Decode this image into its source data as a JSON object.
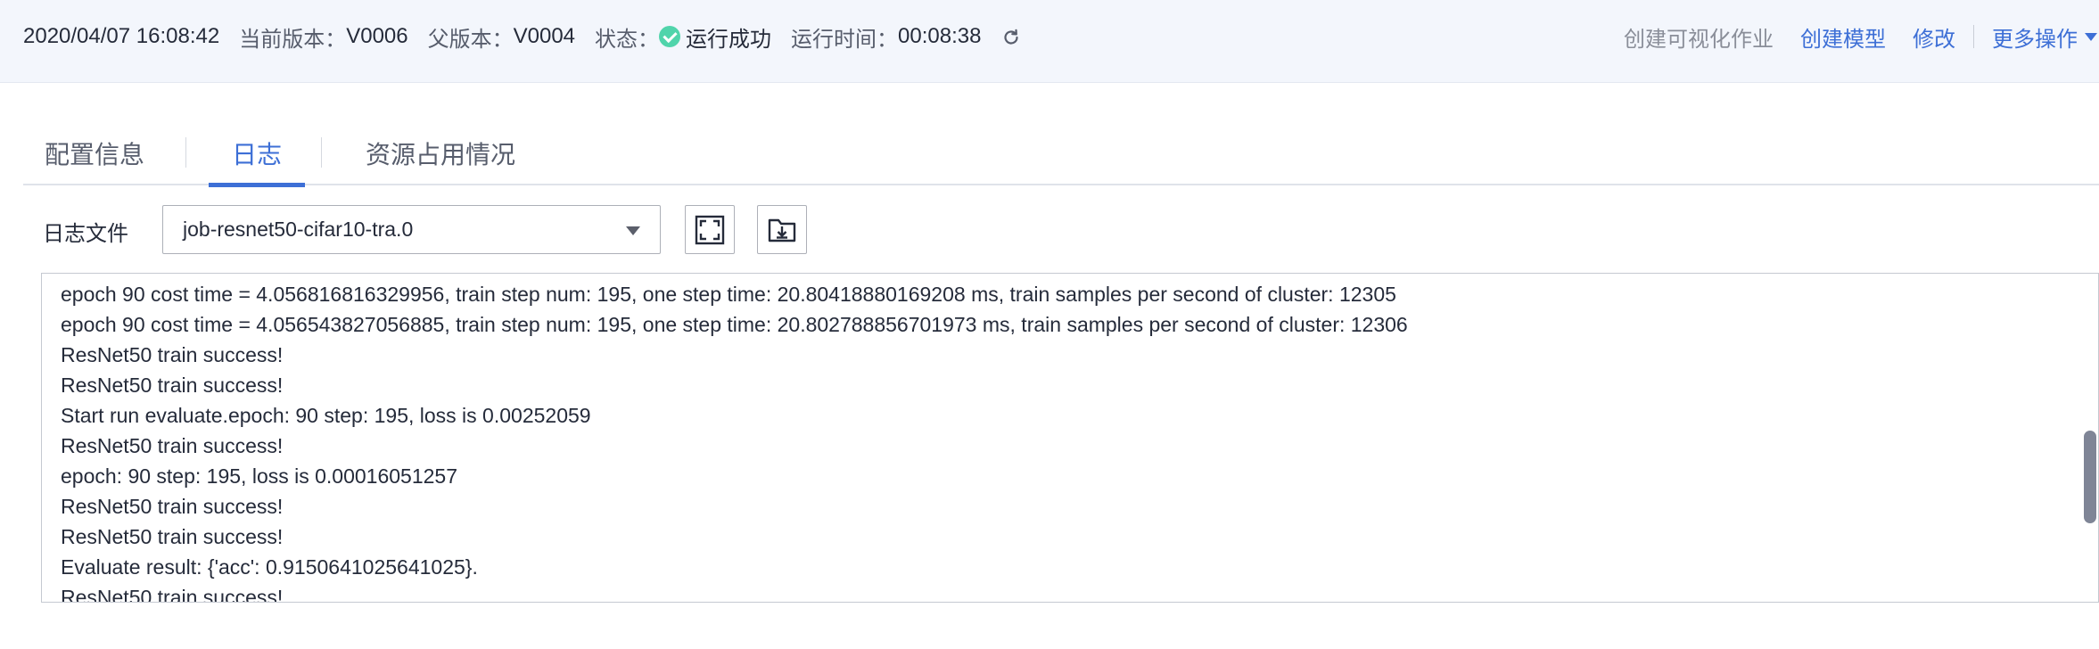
{
  "header": {
    "datetime": "2020/04/07 16:08:42",
    "current_version_label": "当前版本：",
    "current_version": "V0006",
    "parent_version_label": "父版本：",
    "parent_version": "V0004",
    "status_label": "状态：",
    "status_value": "运行成功",
    "runtime_label": "运行时间：",
    "runtime_value": "00:08:38",
    "actions": {
      "create_visual_job": "创建可视化作业",
      "create_model": "创建模型",
      "edit": "修改",
      "more": "更多操作"
    }
  },
  "tabs": [
    "配置信息",
    "日志",
    "资源占用情况"
  ],
  "active_tab": 1,
  "log_file": {
    "label": "日志文件",
    "selected": "job-resnet50-cifar10-tra.0"
  },
  "log_lines": [
    "epoch 90 cost time = 4.056816816329956, train step num: 195, one step time: 20.80418880169208 ms, train samples per second of cluster: 12305",
    "epoch 90 cost time = 4.056543827056885, train step num: 195, one step time: 20.802788856701973 ms, train samples per second of cluster: 12306",
    "ResNet50 train success!",
    "ResNet50 train success!",
    "Start run evaluate.epoch: 90 step: 195, loss is 0.00252059",
    "ResNet50 train success!",
    "epoch: 90 step: 195, loss is 0.00016051257",
    "ResNet50 train success!",
    "ResNet50 train success!",
    "Evaluate result: {'acc': 0.9150641025641025}.",
    "ResNet50 train success!"
  ],
  "colors": {
    "accent": "#3d6fd6",
    "success": "#50d4ab",
    "header_bg": "#f3f6fc"
  }
}
